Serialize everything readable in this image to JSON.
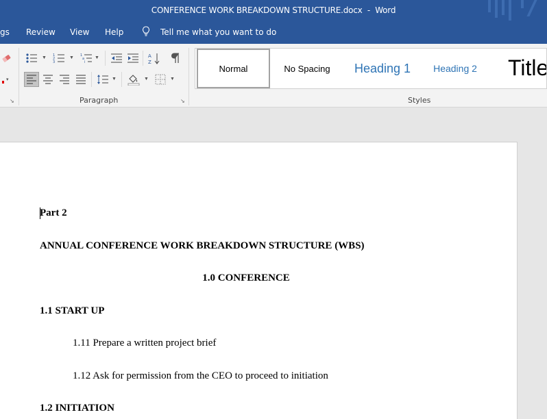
{
  "window": {
    "document_name": "CONFERENCE WORK BREAKDOWN STRUCTURE.docx",
    "separator": "  -  ",
    "app_name": "Word"
  },
  "menu": {
    "items": [
      {
        "label": "gs"
      },
      {
        "label": "Review"
      },
      {
        "label": "View"
      },
      {
        "label": "Help"
      }
    ],
    "tell_me": "Tell me what you want to do"
  },
  "ribbon": {
    "paragraph_label": "Paragraph",
    "styles_label": "Styles",
    "styles": [
      {
        "label": "Normal",
        "color": "#000000"
      },
      {
        "label": "No Spacing",
        "color": "#000000"
      },
      {
        "label": "Heading 1",
        "color": "#2e74b5"
      },
      {
        "label": "Heading 2",
        "color": "#2e74b5"
      },
      {
        "label": "Title",
        "color": "#000000"
      }
    ]
  },
  "document": {
    "lines": [
      {
        "text": "Part 2"
      },
      {
        "text": "ANNUAL CONFERENCE WORK BREAKDOWN STRUCTURE (WBS)"
      },
      {
        "text": "1.0 CONFERENCE"
      },
      {
        "text": "1.1 START UP"
      },
      {
        "text": "1.11 Prepare a written project brief"
      },
      {
        "text": "1.12 Ask for permission from the CEO to proceed to initiation"
      },
      {
        "text": "1.2 INITIATION"
      }
    ]
  },
  "colors": {
    "title_bar": "#2b579a",
    "ribbon_bg": "#f3f3f3",
    "doc_bg": "#e6e6e6",
    "heading_blue": "#2e74b5"
  }
}
